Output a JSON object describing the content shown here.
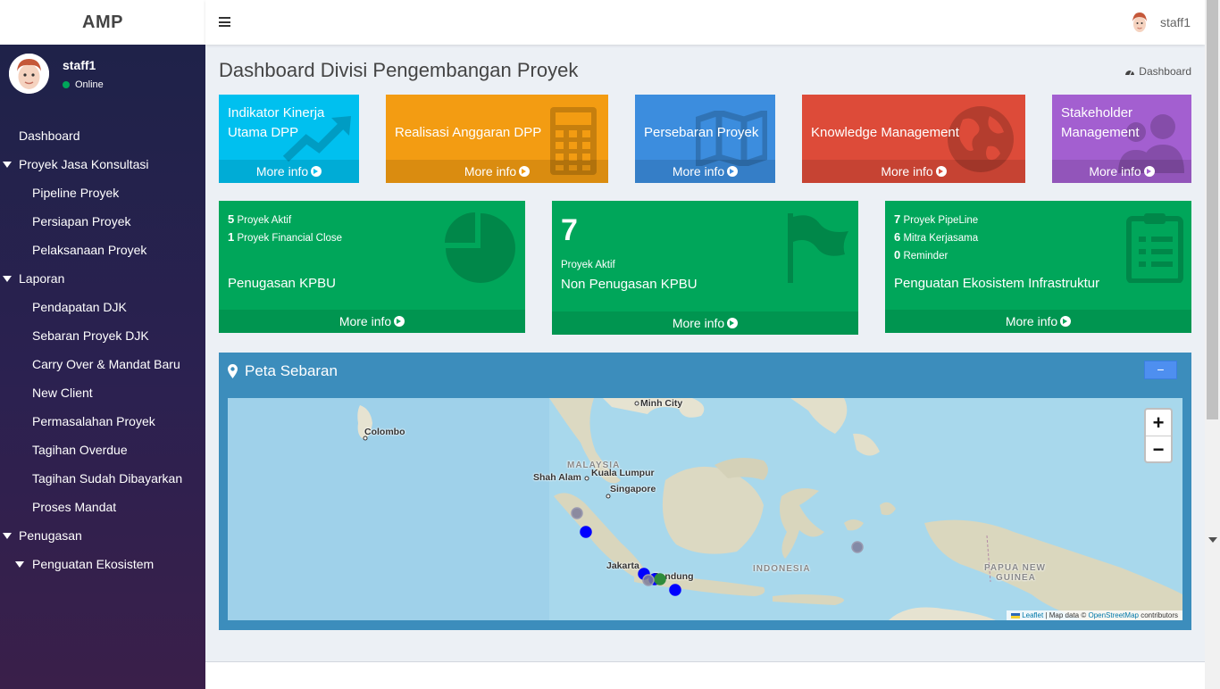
{
  "brand": "AMP",
  "user": {
    "name": "staff1",
    "status": "Online"
  },
  "sidebar": {
    "items": [
      {
        "label": "Dashboard",
        "level": 0,
        "caret": false
      },
      {
        "label": "Proyek Jasa Konsultasi",
        "level": 0,
        "caret": true
      },
      {
        "label": "Pipeline Proyek",
        "level": 1,
        "caret": false
      },
      {
        "label": "Persiapan Proyek",
        "level": 1,
        "caret": false
      },
      {
        "label": "Pelaksanaan Proyek",
        "level": 1,
        "caret": false
      },
      {
        "label": "Laporan",
        "level": 0,
        "caret": true
      },
      {
        "label": "Pendapatan DJK",
        "level": 1,
        "caret": false
      },
      {
        "label": "Sebaran Proyek DJK",
        "level": 1,
        "caret": false
      },
      {
        "label": "Carry Over & Mandat Baru",
        "level": 1,
        "caret": false
      },
      {
        "label": "New Client",
        "level": 1,
        "caret": false
      },
      {
        "label": "Permasalahan Proyek",
        "level": 1,
        "caret": false
      },
      {
        "label": "Tagihan Overdue",
        "level": 1,
        "caret": false
      },
      {
        "label": "Tagihan Sudah Dibayarkan",
        "level": 1,
        "caret": false
      },
      {
        "label": "Proses Mandat",
        "level": 1,
        "caret": false
      },
      {
        "label": "Penugasan",
        "level": 0,
        "caret": true
      },
      {
        "label": "Penguatan Ekosistem",
        "level": 1,
        "caret": true
      }
    ]
  },
  "header": {
    "user_name": "staff1"
  },
  "page": {
    "title": "Dashboard Divisi Pengembangan Proyek",
    "breadcrumb": "Dashboard"
  },
  "more_info": "More info",
  "tiles": [
    {
      "label_line1": "Indikator Kinerja",
      "label_line2": "Utama DPP",
      "icon": "chart-line-icon",
      "color": "#00c0ef"
    },
    {
      "label_line1": "Realisasi Anggaran DPP",
      "icon": "calculator-icon",
      "color": "#f39c12"
    },
    {
      "label_line1": "Persebaran Proyek",
      "icon": "map-icon",
      "color": "#3c8dde"
    },
    {
      "label_line1": "Knowledge Management",
      "icon": "globe-icon",
      "color": "#dd4b39"
    },
    {
      "label_line1": "Stakeholder",
      "label_line2": "Management",
      "icon": "users-icon",
      "color": "#a35fd0"
    }
  ],
  "stats": {
    "kpbu": {
      "active_count": "5",
      "active_label": "Proyek Aktif",
      "fc_count": "1",
      "fc_label": "Proyek Financial Close",
      "title": "Penugasan KPBU",
      "icon": "pie-chart-icon"
    },
    "non_kpbu": {
      "count": "7",
      "label": "Proyek Aktif",
      "title": "Non Penugasan KPBU",
      "icon": "flag-icon"
    },
    "ekosistem": {
      "pipeline_count": "7",
      "pipeline_label": "Proyek PipeLine",
      "mitra_count": "6",
      "mitra_label": "Mitra Kerjasama",
      "reminder_count": "0",
      "reminder_label": "Reminder",
      "title": "Penguatan Ekosistem Infrastruktur",
      "icon": "clipboard-icon"
    }
  },
  "map_panel": {
    "title": "Peta Sebaran",
    "collapse": "−",
    "zoom_in": "+",
    "zoom_out": "−",
    "attribution": {
      "leaflet": "Leaflet",
      "mapdata": "| Map data ©",
      "osm": "OpenStreetMap",
      "contrib": "contributors"
    },
    "places": [
      {
        "name": "Minh City",
        "type": "city"
      },
      {
        "name": "Colombo",
        "type": "city"
      },
      {
        "name": "MALAYSIA",
        "type": "country"
      },
      {
        "name": "Kuala Lumpur",
        "type": "city"
      },
      {
        "name": "Shah Alam",
        "type": "city"
      },
      {
        "name": "Singapore",
        "type": "city"
      },
      {
        "name": "Jakarta",
        "type": "city"
      },
      {
        "name": "Bandung",
        "type": "city"
      },
      {
        "name": "INDONESIA",
        "type": "country"
      },
      {
        "name": "PAPUA NEW",
        "type": "country"
      },
      {
        "name": "GUINEA",
        "type": "country"
      }
    ],
    "marker_colors": {
      "blue": "#0000ff",
      "grey": "#7d7d9a",
      "green": "#2e8b3c"
    }
  }
}
